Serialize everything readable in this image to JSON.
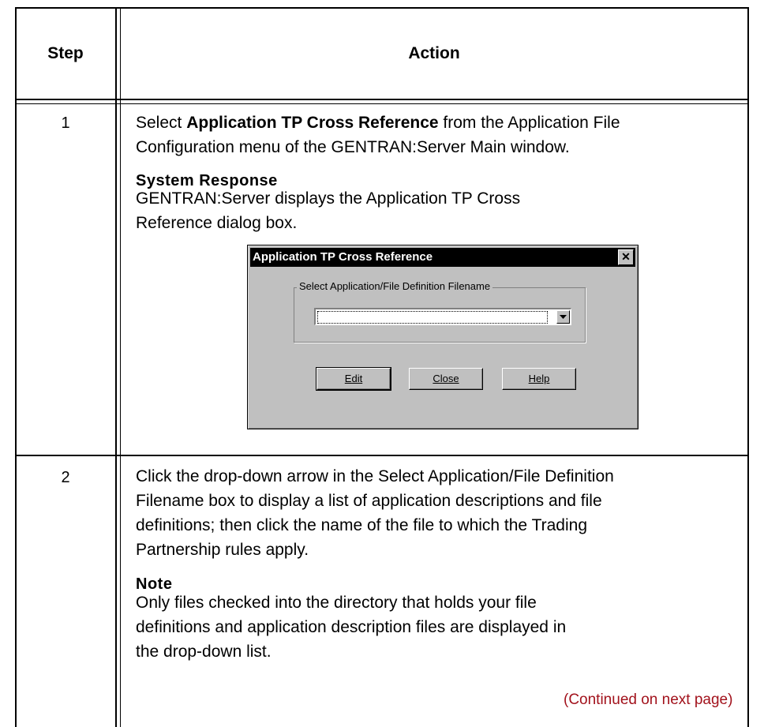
{
  "header": {
    "step": "Step",
    "action": "Action"
  },
  "rows": [
    {
      "step": "1",
      "text_lines": [
        [
          "Select ",
          "Application TP Cross Reference",
          " from the Application File"
        ],
        "Configuration menu of the GENTRAN:Server Main window."
      ],
      "subheading": "System Response",
      "response_lines": [
        "GENTRAN:Server displays the Application TP Cross",
        "Reference dialog box."
      ]
    },
    {
      "step": "2",
      "text_lines": [
        "Click the drop-down arrow in the Select Application/File Definition",
        "Filename box to display a list of application descriptions and file",
        "definitions; then click the name of the file to which the Trading",
        "Partnership rules apply."
      ],
      "subheading": "Note",
      "note_lines": [
        "Only files checked into the directory that holds your file",
        "definitions and application description files are displayed in",
        "the drop-down list."
      ],
      "continued": "(Continued on next page)"
    }
  ],
  "dialog": {
    "title": "Application TP Cross Reference",
    "group_label": "Select Application/File Definition Filename",
    "combo_value": "",
    "buttons": {
      "edit": "Edit",
      "close": "Close",
      "help": "Help"
    }
  }
}
